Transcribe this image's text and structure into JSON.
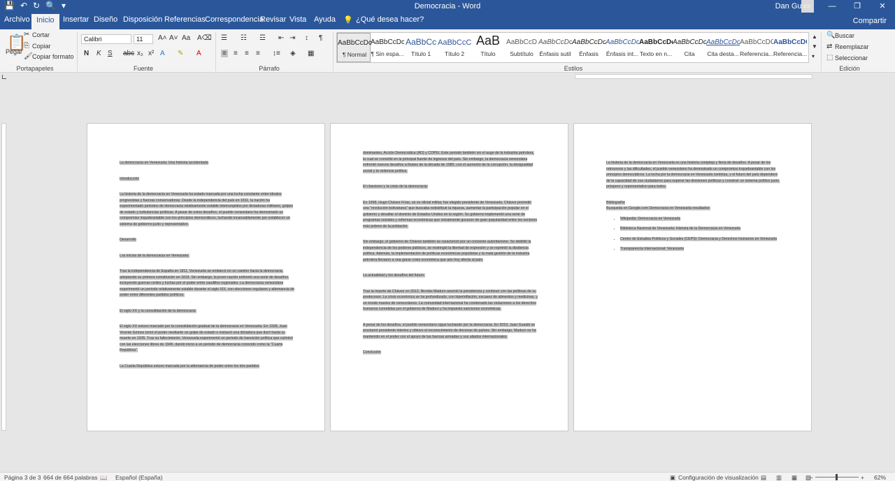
{
  "titlebar": {
    "title": "Democracia - Word",
    "user": "Dan Guti",
    "qat": [
      "💾",
      "↶",
      "↻",
      "🔍",
      "▾"
    ],
    "win": [
      "▭",
      "—",
      "❐",
      "✕"
    ]
  },
  "tabs": [
    "Archivo",
    "Inicio",
    "Insertar",
    "Diseño",
    "Disposición",
    "Referencias",
    "Correspondencia",
    "Revisar",
    "Vista",
    "Ayuda"
  ],
  "tell_me": "¿Qué desea hacer?",
  "share": "Compartir",
  "ribbon": {
    "clipboard": {
      "label": "Portapapeles",
      "paste": "Pegar",
      "cut": "Cortar",
      "copy": "Copiar",
      "format_painter": "Copiar formato"
    },
    "font": {
      "label": "Fuente",
      "name": "Calibri",
      "size": "11"
    },
    "paragraph": {
      "label": "Párrafo"
    },
    "styles": {
      "label": "Estilos",
      "items": [
        {
          "sample": "AaBbCcDc",
          "name": "¶ Normal"
        },
        {
          "sample": "AaBbCcDc",
          "name": "¶ Sin espa..."
        },
        {
          "sample": "AaBbCc",
          "name": "Título 1"
        },
        {
          "sample": "AaBbCcC",
          "name": "Título 2"
        },
        {
          "sample": "AaB",
          "name": "Título"
        },
        {
          "sample": "AaBbCcD",
          "name": "Subtítulo"
        },
        {
          "sample": "AaBbCcDc",
          "name": "Énfasis sutil"
        },
        {
          "sample": "AaBbCcDc",
          "name": "Énfasis"
        },
        {
          "sample": "AaBbCcDc",
          "name": "Énfasis int..."
        },
        {
          "sample": "AaBbCcDc",
          "name": "Texto en n..."
        },
        {
          "sample": "AaBbCcDc",
          "name": "Cita"
        },
        {
          "sample": "AaBbCcDc",
          "name": "Cita desta..."
        },
        {
          "sample": "AaBbCcDC",
          "name": "Referencia..."
        },
        {
          "sample": "AaBbCcDC",
          "name": "Referencia..."
        }
      ]
    },
    "editing": {
      "label": "Edición",
      "find": "Buscar",
      "replace": "Reemplazar",
      "select": "Seleccionar"
    }
  },
  "page1": [
    "La democracia en Venezuela: Una historia accidentada",
    "",
    "Introducción",
    "",
    "La historia de la democracia en Venezuela ha estado marcada por una lucha constante entre ideales progresistas y fuerzas conservadoras. Desde la independencia del país en 1811, la nación ha experimentado periodos de democracia relativamente estable interrumpidos por dictaduras militares, golpes de estado y turbulencias políticas. A pesar de estos desafíos, el pueblo venezolano ha demostrado un compromiso inquebrantable con los principios democráticos, luchando incansablemente por establecer un sistema de gobierno justo y representativo.",
    "",
    "Desarrollo",
    "",
    "Los inicios de la democracia en Venezuela:",
    "",
    "Tras la independencia de España en 1811, Venezuela se embarcó en un camino hacia la democracia, adoptando su primera constitución en 1819. Sin embargo, la joven nación enfrentó una serie de desafíos, incluyendo guerras civiles y luchas por el poder entre caudillos regionales. La democracia venezolana experimentó un periodo relativamente estable durante el siglo XIX, con elecciones regulares y alternancia de poder entre diferentes partidos políticos.",
    "",
    "El siglo XX y la consolidación de la democracia:",
    "",
    "El siglo XX estuvo marcado por la consolidación gradual de la democracia en Venezuela. En 1928, Juan Vicente Gómez tomó el poder mediante un golpe de estado e instauró una dictadura que duró hasta su muerte en 1935. Tras su fallecimiento, Venezuela experimentó un periodo de transición política que culminó con las elecciones libres de 1945, dando inicio a un periodo de democracia conocido como la \"Cuarta República\".",
    "",
    "La Cuarta República estuvo marcada por la alternancia de poder entre los dos partidos"
  ],
  "page2": [
    "dominantes, Acción Democrática (AD) y COPEI. Este periodo también vio el auge de la industria petrolera, la cual se convirtió en la principal fuente de ingresos del país. Sin embargo, la democracia venezolana enfrentó nuevos desafíos a finales de la década de 1980, con el aumento de la corrupción, la desigualdad social y la violencia política.",
    "",
    "El chavismo y la crisis de la democracia:",
    "",
    "En 1998, Hugo Chávez Frías, un ex oficial militar, fue elegido presidente de Venezuela. Chávez prometió una \"revolución bolivariana\" que buscaba redistribuir la riqueza, aumentar la participación popular en el gobierno y desafiar el dominio de Estados Unidos en la región. Su gobierno implementó una serie de programas sociales y reformas económicas que inicialmente gozaron de gran popularidad entre los sectores más pobres de la población.",
    "",
    "Sin embargo, el gobierno de Chávez también se caracterizó por un creciente autoritarismo. Se debilitó la independencia de los poderes públicos, se restringió la libertad de expresión y se reprimió la disidencia política. Además, la implementación de políticas económicas populistas y la mala gestión de la industria petrolera llevaron a una grave crisis económica que aún hoy afecta al país.",
    "",
    "La actualidad y los desafíos del futuro:",
    "",
    "Tras la muerte de Chávez en 2013, Nicolás Maduro asumió la presidencia y continuó con las políticas de su predecesor. La crisis económica se ha profundizado, con hiperinflación, escasez de alimentos y medicinas, y un éxodo masivo de venezolanos. La comunidad internacional ha condenado las violaciones a los derechos humanos cometidas por el gobierno de Maduro y ha impuesto sanciones económicas.",
    "",
    "A pesar de los desafíos, el pueblo venezolano sigue luchando por la democracia. En 2019, Juan Guaidó se proclamó presidente interino y obtuvo el reconocimiento de docenas de países. Sin embargo, Maduro se ha mantenido en el poder con el apoyo de las fuerzas armadas y sus aliados internacionales.",
    "",
    "Conclusión"
  ],
  "page3": {
    "paras": [
      "La historia de la democracia en Venezuela es una historia compleja y llena de desafíos. A pesar de los retrocesos y las dificultades, el pueblo venezolano ha demostrado un compromiso inquebrantable con los principios democráticos. La lucha por la democracia en Venezuela continúa, y el futuro del país dependerá de la capacidad de sus ciudadanos para superar las divisiones políticas y construir un sistema político justo, próspero y representativo para todos.",
      "",
      "Bibliografía:",
      "Busqueda en Google.com Democracia en Venezuela resultados:"
    ],
    "bullets": [
      "Wikipedia: Democracia en Venezuela",
      "Biblioteca Nacional de Venezuela: Historia de la Democracia en Venezuela",
      "Centro de Estudios Políticos y Sociales (CEPS): Democracia y Derechos Humanos en Venezuela",
      "Transparencia Internacional: Venezuela"
    ]
  },
  "status": {
    "page": "Página 3 de 3",
    "words": "664 de 664 palabras",
    "language": "Español (España)",
    "view_settings": "Configuración de visualización",
    "zoom": "62%"
  }
}
